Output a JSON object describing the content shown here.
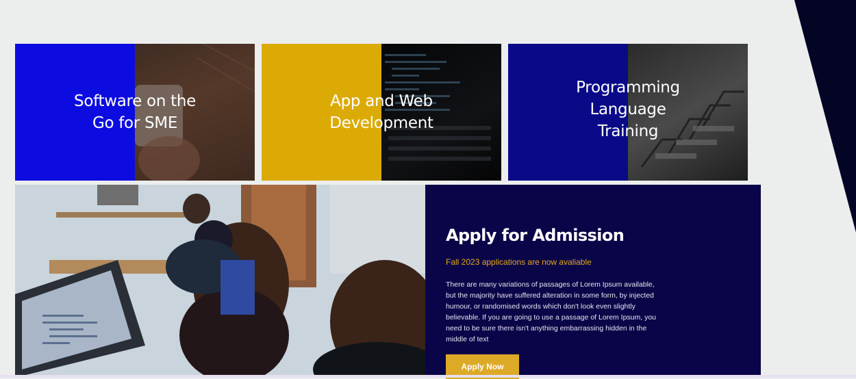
{
  "cards": [
    {
      "title": "Software on the\nGo for SME"
    },
    {
      "title": "App and Web\nDevelopment"
    },
    {
      "title": "Programming\nLanguage\nTraining"
    }
  ],
  "admission": {
    "heading": "Apply for Admission",
    "subtitle": "Fall 2023 applications are now avaliable",
    "body": "There are many variations of passages of Lorem Ipsum available, but the majority have suffered alteration in some form, by injected humour, or randomised words which don't look even slightly believable. If you are going to use a passage of Lorem Ipsum, you need to be sure there isn't anything embarrassing hidden in the middle of text",
    "button_label": "Apply Now"
  },
  "colors": {
    "accent": "#ddaa27",
    "panel": "#0a0548",
    "card1": "#0c0ce0",
    "card2": "#dcaa05",
    "card3": "#0a0a88"
  }
}
